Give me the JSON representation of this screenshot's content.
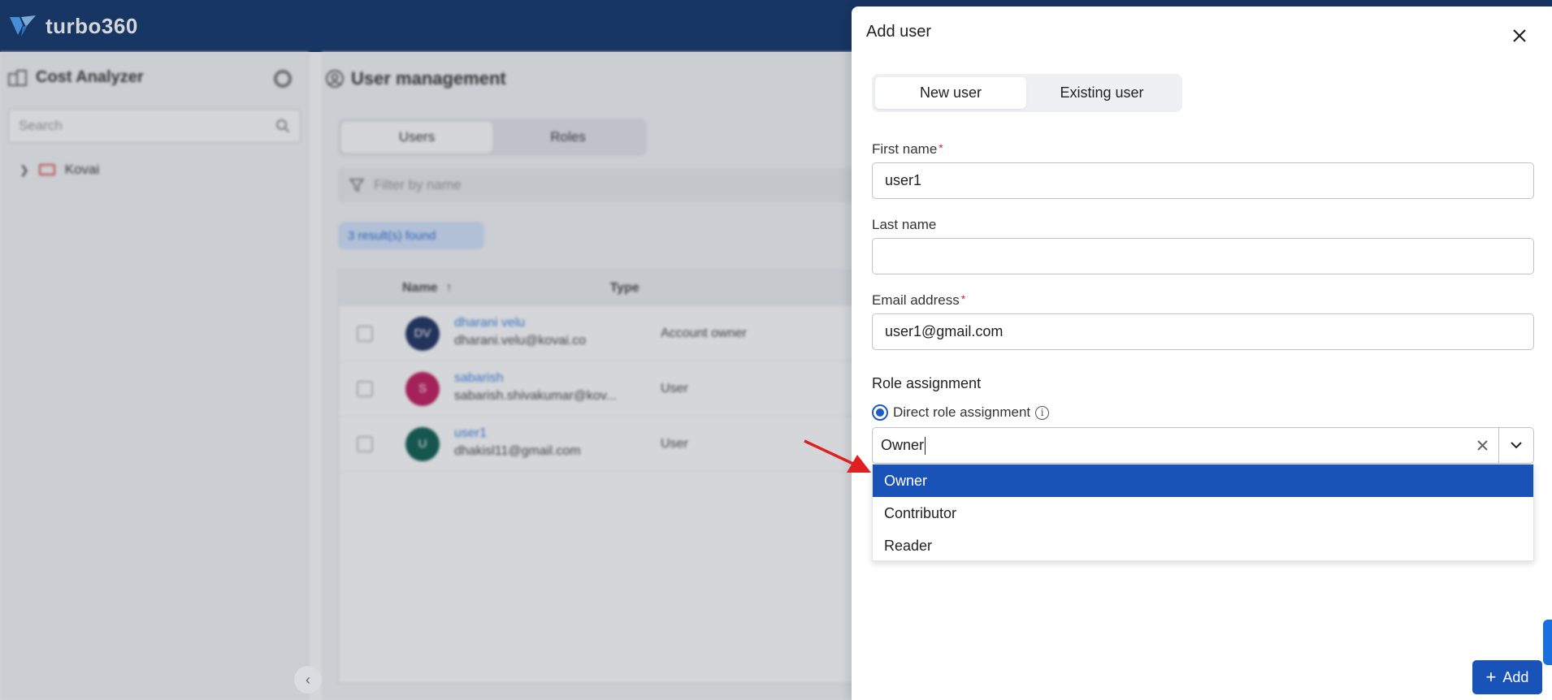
{
  "app": {
    "logo_text": "turbo360",
    "sidebar": {
      "title": "Cost Analyzer",
      "search_placeholder": "Search",
      "tree_item": "Kovai"
    },
    "main": {
      "title": "User management",
      "tabs": [
        "Users",
        "Roles"
      ],
      "filter_placeholder": "Filter by name",
      "result_count": "3 result(s) found",
      "columns": [
        "Name",
        "Type"
      ],
      "rows": [
        {
          "initials": "DV",
          "name": "dharani velu",
          "email": "dharani.velu@kovai.co",
          "type": "Account owner",
          "avatar_color": "#1c2f5f"
        },
        {
          "initials": "S",
          "name": "sabarish",
          "email": "sabarish.shivakumar@kov...",
          "type": "User",
          "avatar_color": "#c2185b"
        },
        {
          "initials": "U",
          "name": "user1",
          "email": "dhakisl11@gmail.com",
          "type": "User",
          "avatar_color": "#0d5c4d"
        }
      ]
    }
  },
  "dialog": {
    "title": "Add user",
    "tabs": {
      "new_user": "New user",
      "existing_user": "Existing user",
      "active": "new_user"
    },
    "fields": {
      "first_name": {
        "label": "First name",
        "required_mark": "*",
        "value": "user1"
      },
      "last_name": {
        "label": "Last name",
        "value": ""
      },
      "email": {
        "label": "Email address",
        "required_mark": "*",
        "value": "user1@gmail.com"
      }
    },
    "role_assignment": {
      "title": "Role assignment",
      "radio_label": "Direct role assignment",
      "info_glyph": "i",
      "select_value": "Owner",
      "options": [
        "Owner",
        "Contributor",
        "Reader"
      ],
      "highlighted_option": "Owner"
    },
    "add_button": {
      "icon": "+",
      "label": "Add"
    }
  },
  "colors": {
    "header": "#0f3368",
    "primary": "#1a53b8",
    "annotation_arrow": "#e02020"
  }
}
